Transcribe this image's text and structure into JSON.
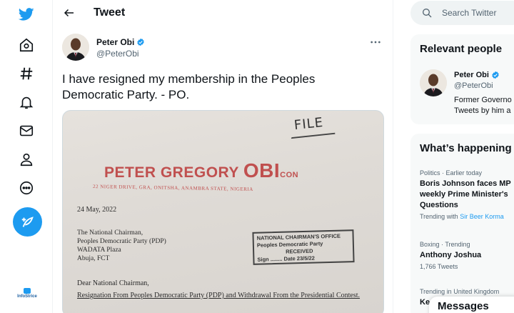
{
  "colors": {
    "accent": "#1d9bf0",
    "text": "#0f1419",
    "muted": "#536471",
    "doc_red": "#c0504f"
  },
  "nav": {
    "items": [
      {
        "name": "twitter-logo-icon"
      },
      {
        "name": "home-icon"
      },
      {
        "name": "explore-hashtag-icon"
      },
      {
        "name": "notifications-bell-icon"
      },
      {
        "name": "messages-envelope-icon"
      },
      {
        "name": "profile-person-icon"
      },
      {
        "name": "more-options-icon"
      }
    ],
    "compose_icon": "compose-tweet-icon",
    "footer_logo": "InfoStrice"
  },
  "header": {
    "title": "Tweet"
  },
  "tweet": {
    "author_name": "Peter Obi",
    "author_handle": "@PeterObi",
    "text": "I have resigned my membership in the Peoples Democratic Party. - PO.",
    "document": {
      "file_note": "FILE",
      "name_prefix": "PETER GREGORY ",
      "name_main": "OBI",
      "name_suffix": "CON",
      "address": "22 NIGER DRIVE, GRA, ONITSHA, ANAMBRA STATE, NIGERIA",
      "date": "24 May, 2022",
      "recipient_lines": [
        "The National Chairman,",
        "Peoples Democratic Party (PDP)",
        "WADATA Plaza",
        "Abuja, FCT"
      ],
      "stamp_lines": [
        "NATIONAL CHAIRMAN'S OFFICE",
        "Peoples Democratic Party",
        "RECEIVED",
        "Sign ........ Date 23/5/22"
      ],
      "salutation": "Dear National Chairman,",
      "subject": "Resignation From Peoples Democratic Party (PDP) and Withdrawal From the Presidential Contest."
    }
  },
  "right": {
    "search_placeholder": "Search Twitter",
    "relevant_people": {
      "title": "Relevant people",
      "name": "Peter Obi",
      "handle": "@PeterObi",
      "bio_line1": "Former Governo",
      "bio_line2": "Tweets by him a"
    },
    "happening": {
      "title": "What’s happening",
      "trends": [
        {
          "meta": "Politics · Earlier today",
          "title_lines": [
            "Boris Johnson faces MP",
            "weekly Prime Minister's",
            "Questions"
          ],
          "sub_prefix": "Trending with ",
          "sub_link": "Sir Beer Korma"
        },
        {
          "meta": "Boxing · Trending",
          "title_lines": [
            "Anthony Joshua"
          ],
          "sub": "1,766 Tweets"
        },
        {
          "meta": "Trending in United Kingdom",
          "title_lines": [
            "Ke"
          ]
        }
      ]
    },
    "messages_label": "Messages"
  }
}
